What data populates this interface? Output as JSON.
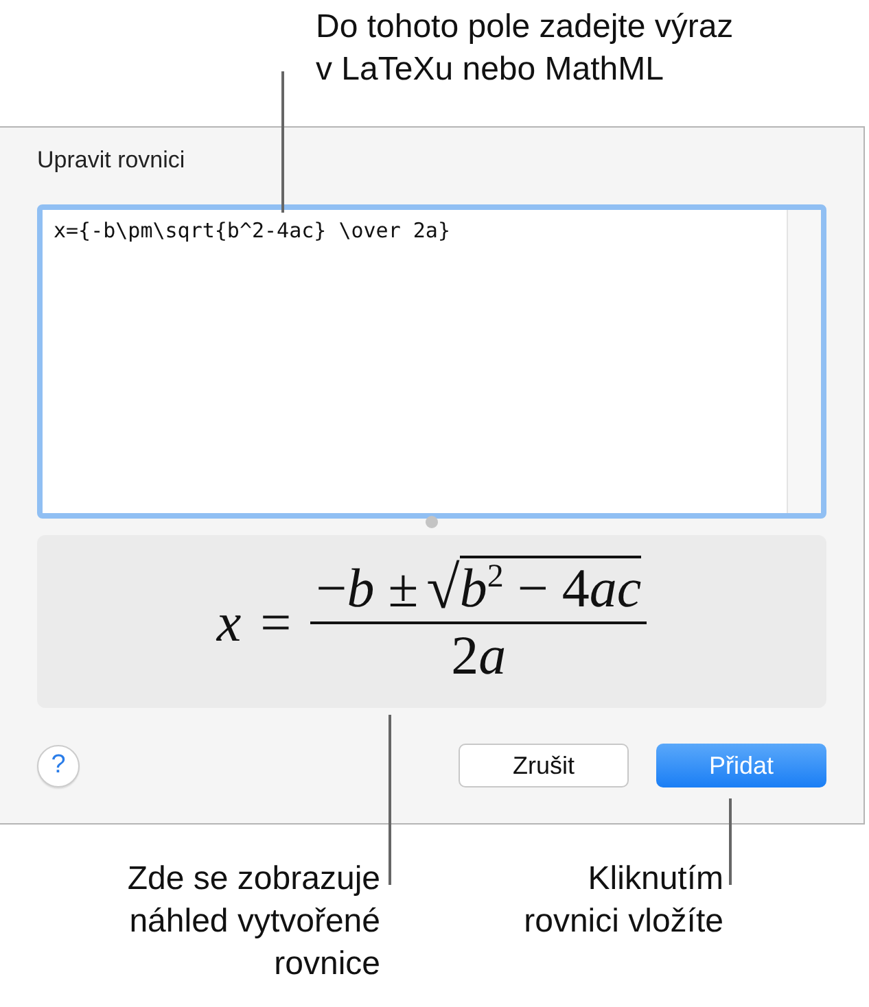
{
  "callout_top": {
    "lines": [
      "Do tohoto pole zadejte výraz",
      "v LaTeXu nebo MathML"
    ]
  },
  "dialog": {
    "title": "Upravit rovnici",
    "editor": {
      "value": "x={-b\\pm\\sqrt{b^2-4ac} \\over 2a}",
      "focused": true
    },
    "preview": {
      "lhs": "*x*",
      "equals": "=",
      "numerator": "−*b* ±",
      "radical": "√",
      "radicand": [
        {
          "text": "b",
          "kind": "variable"
        },
        {
          "text": "2",
          "kind": "exponent"
        },
        {
          "text": " − 4",
          "kind": "number"
        },
        {
          "text": "ac",
          "kind": "variable"
        }
      ],
      "denominator": [
        {
          "text": "2",
          "kind": "number"
        },
        {
          "text": "a",
          "kind": "variable"
        }
      ]
    },
    "help": "?",
    "buttons": [
      {
        "label": "Zrušit",
        "kind": "secondary"
      },
      {
        "label": "Přidat",
        "kind": "primary"
      }
    ]
  },
  "callouts_bottom": [
    {
      "lines": [
        "Zde se zobrazuje",
        "náhled vytvořené",
        "rovnice"
      ]
    },
    {
      "lines": [
        "Kliknutím",
        "rovnici vložíte"
      ]
    }
  ]
}
